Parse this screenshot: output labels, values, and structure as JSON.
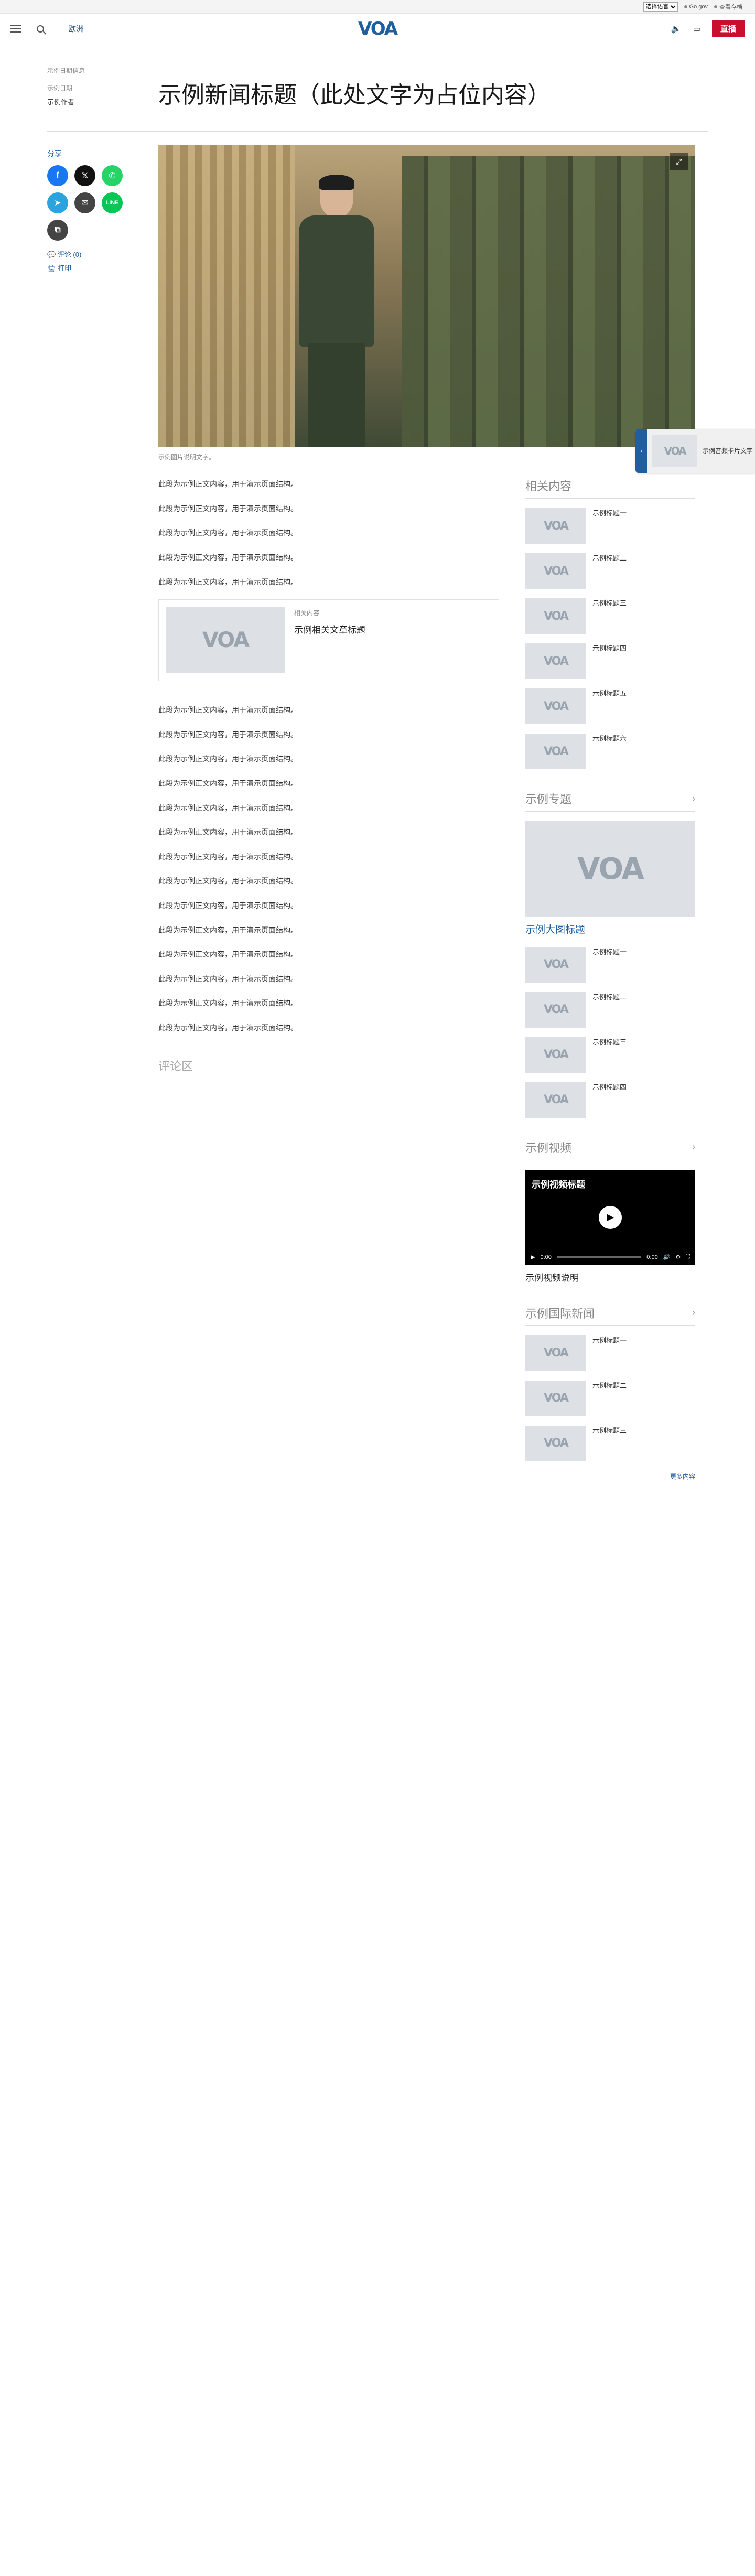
{
  "utility": {
    "language_select": "选择语言",
    "link_1": "Go gov",
    "link_2": "查看存档"
  },
  "header": {
    "section_link": "欧洲",
    "logo": "VOA",
    "live_label": "直播"
  },
  "article": {
    "meta_top": "示例日期信息",
    "date": "示例日期",
    "byline": "示例作者",
    "title": "示例新闻标题（此处文字为占位内容）",
    "share_label": "分享",
    "comments_link": "评论 (0)",
    "print_link": "打印",
    "caption": "示例图片说明文字。",
    "paragraphs_a": [
      "此段为示例正文内容，用于演示页面结构。",
      "此段为示例正文内容，用于演示页面结构。",
      "此段为示例正文内容，用于演示页面结构。",
      "此段为示例正文内容，用于演示页面结构。",
      "此段为示例正文内容，用于演示页面结构。"
    ],
    "related": {
      "label": "相关内容",
      "title": "示例相关文章标题"
    },
    "paragraphs_b": [
      "此段为示例正文内容，用于演示页面结构。",
      "此段为示例正文内容，用于演示页面结构。",
      "此段为示例正文内容，用于演示页面结构。",
      "此段为示例正文内容，用于演示页面结构。",
      "此段为示例正文内容，用于演示页面结构。",
      "此段为示例正文内容，用于演示页面结构。",
      "此段为示例正文内容，用于演示页面结构。",
      "此段为示例正文内容，用于演示页面结构。",
      "此段为示例正文内容，用于演示页面结构。",
      "此段为示例正文内容，用于演示页面结构。",
      "此段为示例正文内容，用于演示页面结构。",
      "此段为示例正文内容，用于演示页面结构。",
      "此段为示例正文内容，用于演示页面结构。",
      "此段为示例正文内容，用于演示页面结构。"
    ],
    "comments_heading": "评论区"
  },
  "float_card": {
    "text": "示例音频卡片文字"
  },
  "rail": {
    "related_heading": "相关内容",
    "related_items": [
      "示例标题一",
      "示例标题二",
      "示例标题三",
      "示例标题四",
      "示例标题五",
      "示例标题六"
    ],
    "ukraine_heading": "示例专题",
    "ukraine_big_title": "示例大图标题",
    "ukraine_items": [
      "示例标题一",
      "示例标题二",
      "示例标题三",
      "示例标题四"
    ],
    "video_heading": "示例视频",
    "video_title": "示例视频标题",
    "video_time_current": "0:00",
    "video_time_total": "0:00",
    "video_progress": 0,
    "video_caption": "示例视频说明",
    "intl_heading": "示例国际新闻",
    "intl_items": [
      "示例标题一",
      "示例标题二",
      "示例标题三"
    ],
    "more_link": "更多内容"
  }
}
